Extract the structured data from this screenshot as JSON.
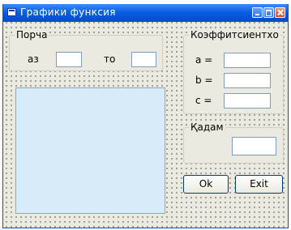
{
  "window": {
    "title": "Графики функсия",
    "minimize_label": "",
    "maximize_label": "",
    "close_label": ""
  },
  "range_group": {
    "caption": "Порча",
    "from_label": "аз",
    "from_value": "",
    "to_label": "то",
    "to_value": ""
  },
  "coeff_group": {
    "caption": "Коэффитсиентхо",
    "a_label": "a =",
    "a_value": "",
    "b_label": "b =",
    "b_value": "",
    "c_label": "c =",
    "c_value": ""
  },
  "step_group": {
    "caption": "Қадам",
    "step_value": ""
  },
  "buttons": {
    "ok_label": "Ok",
    "exit_label": "Exit"
  }
}
